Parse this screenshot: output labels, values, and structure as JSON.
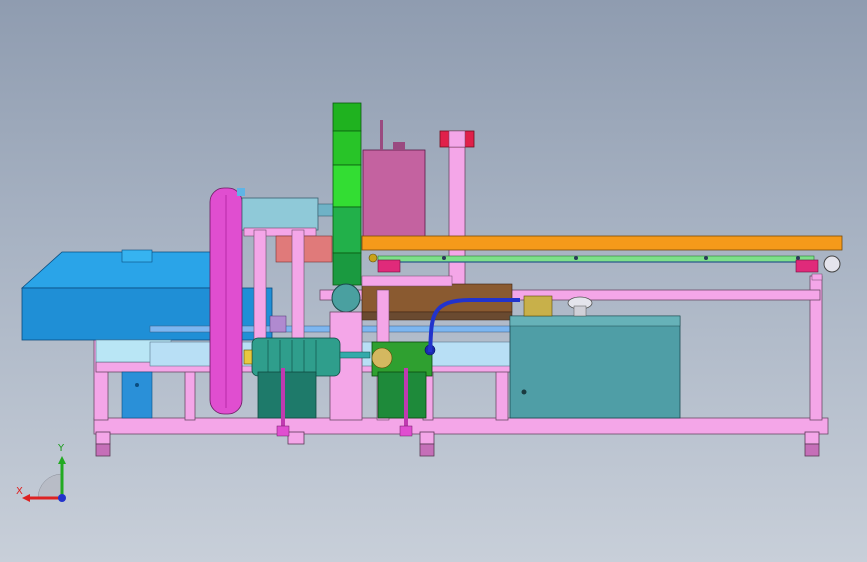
{
  "view": {
    "type": "cad-front-view",
    "background_colors": [
      "#8f9cb0",
      "#c8cfd9"
    ]
  },
  "triad": {
    "x_label": "X",
    "y_label": "Y",
    "x_color": "#dd2222",
    "y_color": "#22aa22",
    "z_color": "#2233cc"
  },
  "parts": {
    "frame_color": "#f4a6e8",
    "conveyor_color": "#f59a1a",
    "hopper_color": "#1e90d8",
    "motor_color": "#2f9e8c",
    "tank_color": "#4f9ea6",
    "column_color": "#22c23a",
    "box_color": "#c462a0",
    "belt_guard_color": "#e04ed0"
  }
}
